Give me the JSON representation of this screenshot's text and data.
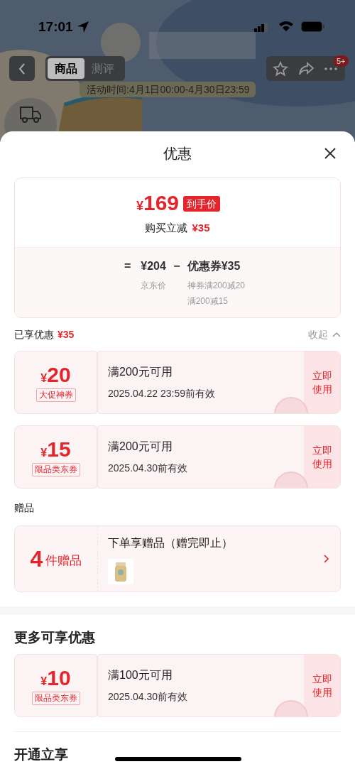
{
  "status_bar": {
    "time": "17:01"
  },
  "nav": {
    "tabs": [
      {
        "label": "商品",
        "selected": true
      },
      {
        "label": "测评",
        "selected": false
      }
    ],
    "banner": "活动时间:4月1日00:00-4月30日23:59",
    "badge": "5+"
  },
  "sheet": {
    "title": "优惠",
    "price": {
      "symbol": "¥",
      "amount": "169",
      "tag": "到手价",
      "saving_label": "购买立减",
      "saving": "¥35",
      "equals": "=",
      "base": "¥204",
      "base_label": "京东价",
      "minus": "−",
      "coupon": "优惠券¥35",
      "coupon_details": [
        "神券满200减20",
        "满200减15"
      ]
    },
    "enjoyed": {
      "label": "已享优惠",
      "amount": "¥35",
      "toggle": "收起"
    },
    "coupons": [
      {
        "symbol": "¥",
        "amount": "20",
        "tag": "大促神券",
        "condition": "满200元可用",
        "validity": "2025.04.22 23:59前有效",
        "action": "立即使用"
      },
      {
        "symbol": "¥",
        "amount": "15",
        "tag": "限品类东券",
        "condition": "满200元可用",
        "validity": "2025.04.30前有效",
        "action": "立即使用"
      }
    ],
    "gifts": {
      "heading": "赠品",
      "count": "4",
      "unit": "件赠品",
      "title": "下单享赠品（赠完即止）"
    },
    "more": {
      "heading": "更多可享优惠",
      "coupons": [
        {
          "symbol": "¥",
          "amount": "10",
          "tag": "限品类东券",
          "condition": "满100元可用",
          "validity": "2025.04.30前有效",
          "action": "立即使用"
        }
      ]
    },
    "next_heading": "开通立享"
  }
}
